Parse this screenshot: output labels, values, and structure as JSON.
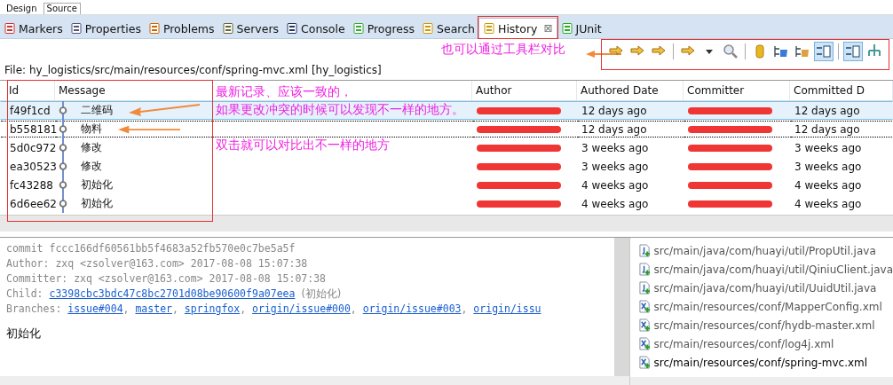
{
  "editor_tabs": [
    {
      "label": "Design",
      "selected": false
    },
    {
      "label": "Source",
      "selected": true
    }
  ],
  "view_tabs": [
    {
      "label": "Markers",
      "selected": false,
      "framed": false
    },
    {
      "label": "Properties",
      "selected": false,
      "framed": false
    },
    {
      "label": "Problems",
      "selected": false,
      "framed": false
    },
    {
      "label": "Servers",
      "selected": false,
      "framed": false
    },
    {
      "label": "Console",
      "selected": false,
      "framed": false
    },
    {
      "label": "Progress",
      "selected": false,
      "framed": false
    },
    {
      "label": "Search",
      "selected": false,
      "framed": false
    },
    {
      "label": "History",
      "selected": true,
      "framed": true,
      "close": "⊠"
    },
    {
      "label": "JUnit",
      "selected": false,
      "framed": false
    }
  ],
  "toolbar": [
    {
      "pressed": false
    },
    {
      "pressed": false
    },
    {
      "pressed": false
    },
    {
      "pressed": false
    },
    {
      "pressed": false
    },
    {
      "pressed": false
    },
    {
      "pressed": false
    },
    {
      "pressed": false
    },
    {
      "pressed": false
    },
    {
      "pressed": true
    },
    {
      "pressed": true
    },
    {
      "pressed": false
    }
  ],
  "file_line": "File: hy_logistics/src/main/resources/conf/spring-mvc.xml [hy_logistics]",
  "table": {
    "columns": [
      "Id",
      "Message",
      "Author",
      "Authored Date",
      "Committer",
      "Committed D"
    ],
    "rows": [
      {
        "id": "f49f1cd",
        "message": "二维码",
        "author_redacted": true,
        "authored": "12 days ago",
        "committer_redacted": true,
        "committed": "12 days ago",
        "selected": true,
        "focused": false
      },
      {
        "id": "b558181",
        "message": "物料",
        "author_redacted": true,
        "authored": "12 days ago",
        "committer_redacted": true,
        "committed": "12 days ago",
        "selected": false,
        "focused": true
      },
      {
        "id": "5d0c972",
        "message": "修改",
        "author_redacted": true,
        "authored": "3 weeks ago",
        "committer_redacted": true,
        "committed": "3 weeks ago",
        "selected": false,
        "focused": false
      },
      {
        "id": "ea30523",
        "message": "修改",
        "author_redacted": true,
        "authored": "3 weeks ago",
        "committer_redacted": true,
        "committed": "3 weeks ago",
        "selected": false,
        "focused": false
      },
      {
        "id": "fc43288",
        "message": "初始化",
        "author_redacted": true,
        "authored": "4 weeks ago",
        "committer_redacted": true,
        "committed": "4 weeks ago",
        "selected": false,
        "focused": false
      },
      {
        "id": "6d6ee62",
        "message": "初始化",
        "author_redacted": true,
        "authored": "4 weeks ago",
        "committer_redacted": true,
        "committed": "4 weeks ago",
        "selected": false,
        "focused": false
      }
    ]
  },
  "commit": {
    "lines": [
      "commit fccc166df60561bb5f4683a52fb570e0c7be5a5f",
      "Author: zxq <zsolver@163.com> 2017-08-08 15:07:38",
      "Committer: zxq <zsolver@163.com> 2017-08-08 15:07:38"
    ],
    "child_label": "Child:",
    "child_link": "c3398cbc3bdc47c8bc2701d08be90600f9a07eea",
    "child_message": "(初始化)",
    "branches_label": "Branches:",
    "branch_separator": ",",
    "branches": [
      "issue#004",
      "master",
      "springfox",
      "origin/issue#000",
      "origin/issue#003",
      "origin/issu"
    ],
    "message": "初始化"
  },
  "files": [
    {
      "path": "src/main/java/com/huayi/util/PropUtil.java",
      "kind": "java",
      "current": false
    },
    {
      "path": "src/main/java/com/huayi/util/QiniuClient.java",
      "kind": "java",
      "current": false
    },
    {
      "path": "src/main/java/com/huayi/util/UuidUtil.java",
      "kind": "java",
      "current": false
    },
    {
      "path": "src/main/resources/conf/MapperConfig.xml",
      "kind": "xml",
      "current": false
    },
    {
      "path": "src/main/resources/conf/hydb-master.xml",
      "kind": "xml",
      "current": false
    },
    {
      "path": "src/main/resources/conf/log4j.xml",
      "kind": "xml",
      "current": false
    },
    {
      "path": "src/main/resources/conf/spring-mvc.xml",
      "kind": "xml",
      "current": true
    }
  ],
  "annotations": {
    "toolbar_note": "也可以通过工具栏对比",
    "latest_note": [
      "最新记录、应该一致的，",
      "如果更改冲突的时候可以发现不一样的地方。"
    ],
    "double_click_note": "双击就可以对比出不一样的地方"
  }
}
